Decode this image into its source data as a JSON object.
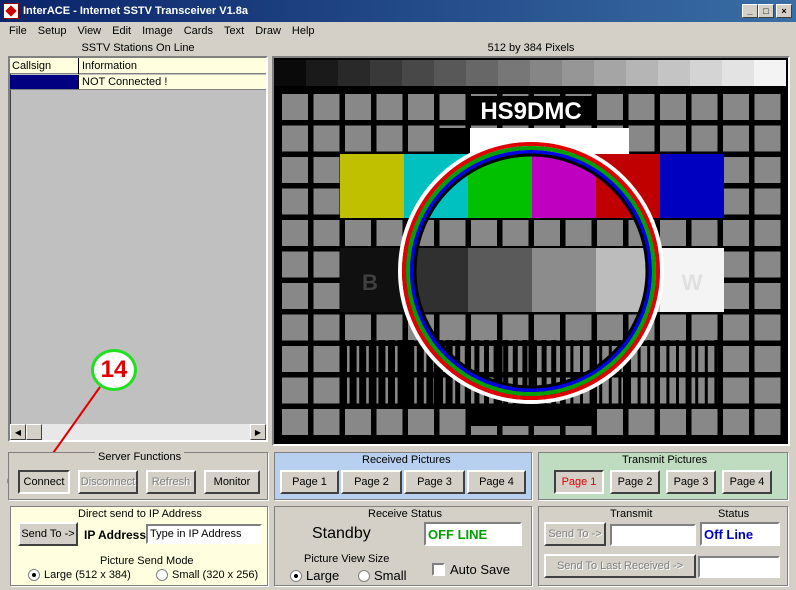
{
  "window": {
    "title": "InterACE - Internet SSTV Transceiver V1.8a",
    "controls": [
      "_",
      "□",
      "×"
    ]
  },
  "menu": [
    "File",
    "Setup",
    "View",
    "Edit",
    "Image",
    "Cards",
    "Text",
    "Draw",
    "Help"
  ],
  "stations": {
    "caption": "SSTV Stations On Line",
    "headers": [
      "Callsign",
      "Information"
    ],
    "rows": [
      {
        "callsign": "",
        "info": "NOT Connected !"
      }
    ]
  },
  "picture": {
    "caption": "512 by 384 Pixels",
    "callsign": "HS9DMC",
    "black_label": "B",
    "white_label": "W"
  },
  "annotation": {
    "number": "14"
  },
  "server": {
    "title": "Server Functions",
    "connect": "Connect",
    "disconnect": "Disconnect",
    "refresh": "Refresh",
    "monitor": "Monitor"
  },
  "direct": {
    "title": "Direct send to IP Address",
    "send_to": "Send To ->",
    "ip_label": "IP Address",
    "ip_value": "Type in IP Address"
  },
  "send_mode": {
    "title": "Picture Send Mode",
    "large": "Large (512 x 384)",
    "small": "Small (320 x 256)",
    "selected": "large"
  },
  "received": {
    "title": "Received Pictures",
    "pages": [
      "Page 1",
      "Page 2",
      "Page 3",
      "Page 4"
    ]
  },
  "receive_status": {
    "title": "Receive Status",
    "state": "Standby",
    "line": "OFF LINE"
  },
  "view_size": {
    "title": "Picture View Size",
    "large": "Large",
    "small": "Small",
    "selected": "large"
  },
  "autosave": {
    "label": "Auto Save"
  },
  "transmit_pictures": {
    "title": "Transmit Pictures",
    "pages": [
      "Page 1",
      "Page 2",
      "Page 3",
      "Page 4"
    ],
    "active": 0
  },
  "transmit": {
    "title": "Transmit",
    "send_to": "Send To ->",
    "send_last": "Send To  Last Received ->",
    "status_title": "Status",
    "status": "Off Line"
  },
  "colors": {
    "accent_red": "#e00000",
    "annotation_green": "#20e020",
    "status_green": "#00a000",
    "status_blue": "#0000c0"
  }
}
